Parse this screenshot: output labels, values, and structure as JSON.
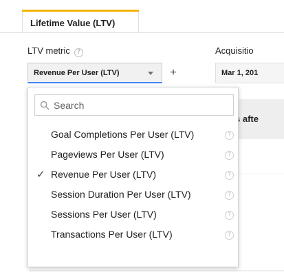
{
  "tabs": [
    {
      "label": "Lifetime Value (LTV)",
      "active": true,
      "accent_color": "#f4b400"
    }
  ],
  "ltv_metric": {
    "label": "LTV metric",
    "help_glyph": "?",
    "selected_value": "Revenue Per User (LTV)",
    "add_label": "+"
  },
  "acquisition": {
    "label": "Acquisitio",
    "date_value": "Mar 1, 201"
  },
  "background": {
    "header_text": "s afte"
  },
  "dropdown": {
    "search": {
      "placeholder": "Search",
      "value": ""
    },
    "options": [
      {
        "label": "Goal Completions Per User (LTV)",
        "selected": false,
        "help_glyph": "?"
      },
      {
        "label": "Pageviews Per User (LTV)",
        "selected": false,
        "help_glyph": "?"
      },
      {
        "label": "Revenue Per User (LTV)",
        "selected": true,
        "help_glyph": "?"
      },
      {
        "label": "Session Duration Per User (LTV)",
        "selected": false,
        "help_glyph": "?"
      },
      {
        "label": "Sessions Per User (LTV)",
        "selected": false,
        "help_glyph": "?"
      },
      {
        "label": "Transactions Per User (LTV)",
        "selected": false,
        "help_glyph": "?"
      }
    ],
    "check_glyph": "✓"
  },
  "colors": {
    "focus_underline": "#4285f4",
    "tab_accent": "#f4b400"
  }
}
